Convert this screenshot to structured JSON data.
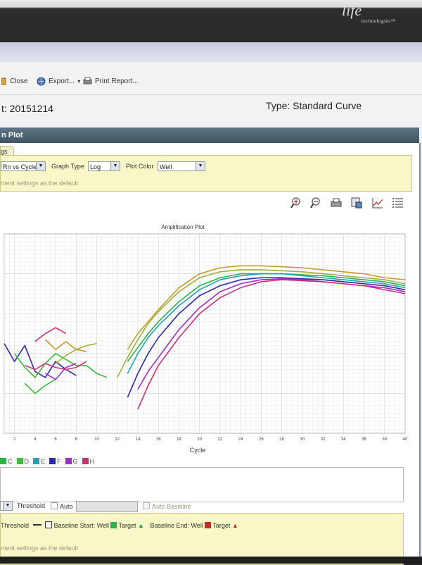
{
  "brand": {
    "logo_main": "life",
    "logo_sub": "technologies™"
  },
  "toolbar": {
    "close": "Close",
    "export": "Export...",
    "print": "Print Report..."
  },
  "experiment": {
    "title": "t: 20151214",
    "type": "Type: Standard Curve"
  },
  "panel": {
    "title": "n Plot",
    "settings_tab": "gs"
  },
  "settings": {
    "plot_type_value": "Rn vs Cycle",
    "graph_type_label": "Graph Type",
    "graph_type_value": "Log",
    "plot_color_label": "Plot Color",
    "plot_color_value": "Well",
    "default_text": "ment settings as the default"
  },
  "plot_toolbar_icons": [
    "zoom-in-icon",
    "zoom-out-icon",
    "print-icon",
    "save-image-icon",
    "line-chart-icon",
    "list-icon"
  ],
  "legend": [
    {
      "label": "C",
      "color": "#2db24a"
    },
    {
      "label": "D",
      "color": "#3cbf3c"
    },
    {
      "label": "E",
      "color": "#21a3b3"
    },
    {
      "label": "F",
      "color": "#2a2aa8"
    },
    {
      "label": "G",
      "color": "#9a2fc9"
    },
    {
      "label": "H",
      "color": "#cc2f7a"
    }
  ],
  "threshold": {
    "label": "Threshold",
    "auto_label": "Auto",
    "auto_baseline_label": "Auto Baseline",
    "row_label": "Threshold",
    "baseline_start": "Baseline Start: Well",
    "target": "Target",
    "baseline_end": "Baseline End: Well",
    "target2": "Target",
    "default_text": "ment settings as the default"
  },
  "chart_data": {
    "type": "line",
    "title": "Amplification Plot",
    "xlabel": "Cycle",
    "ylabel": "",
    "x_ticks": [
      2,
      4,
      6,
      8,
      10,
      12,
      14,
      16,
      18,
      20,
      22,
      24,
      26,
      28,
      30,
      32,
      34,
      36,
      38,
      40
    ],
    "xlim": [
      1,
      40
    ],
    "ylim": [
      0,
      1
    ],
    "log_scale": true,
    "grid": true,
    "series": [
      {
        "color": "#c99a2a",
        "x": [
          13,
          14,
          15,
          16,
          18,
          20,
          22,
          24,
          26,
          28,
          30,
          32,
          34,
          36,
          38,
          40
        ],
        "y": [
          0.42,
          0.5,
          0.56,
          0.62,
          0.73,
          0.8,
          0.83,
          0.84,
          0.84,
          0.835,
          0.83,
          0.82,
          0.81,
          0.8,
          0.78,
          0.77
        ]
      },
      {
        "color": "#9ab23a",
        "x": [
          12,
          13,
          14,
          15,
          16,
          18,
          20,
          22,
          24,
          26,
          28,
          30,
          32,
          34,
          36,
          38,
          40
        ],
        "y": [
          0.28,
          0.38,
          0.47,
          0.55,
          0.61,
          0.71,
          0.78,
          0.81,
          0.82,
          0.82,
          0.815,
          0.81,
          0.8,
          0.79,
          0.78,
          0.77,
          0.75
        ]
      },
      {
        "color": "#2db24a",
        "x": [
          13,
          14,
          15,
          16,
          18,
          20,
          22,
          24,
          26,
          28,
          30,
          32,
          34,
          36,
          38,
          40
        ],
        "y": [
          0.36,
          0.43,
          0.5,
          0.56,
          0.66,
          0.74,
          0.78,
          0.8,
          0.8,
          0.8,
          0.795,
          0.79,
          0.78,
          0.77,
          0.76,
          0.74
        ]
      },
      {
        "color": "#21a3b3",
        "x": [
          13,
          14,
          15,
          16,
          18,
          20,
          22,
          24,
          26,
          28,
          30,
          32,
          34,
          36,
          38,
          40
        ],
        "y": [
          0.3,
          0.4,
          0.48,
          0.54,
          0.64,
          0.72,
          0.77,
          0.79,
          0.8,
          0.8,
          0.79,
          0.78,
          0.77,
          0.76,
          0.75,
          0.73
        ]
      },
      {
        "color": "#2a2aa8",
        "x": [
          13,
          14,
          15,
          16,
          18,
          20,
          22,
          24,
          26,
          28,
          30,
          32,
          34,
          36,
          38,
          40
        ],
        "y": [
          0.18,
          0.3,
          0.4,
          0.48,
          0.6,
          0.69,
          0.74,
          0.77,
          0.78,
          0.78,
          0.775,
          0.77,
          0.76,
          0.75,
          0.74,
          0.72
        ]
      },
      {
        "color": "#9a2fc9",
        "x": [
          14,
          15,
          16,
          18,
          20,
          22,
          24,
          26,
          28,
          30,
          32,
          34,
          36,
          38,
          40
        ],
        "y": [
          0.22,
          0.31,
          0.38,
          0.52,
          0.63,
          0.71,
          0.75,
          0.77,
          0.775,
          0.77,
          0.76,
          0.75,
          0.74,
          0.73,
          0.71
        ]
      },
      {
        "color": "#cc2f7a",
        "x": [
          14,
          15,
          16,
          18,
          20,
          22,
          24,
          26,
          28,
          30,
          32,
          34,
          36,
          38,
          40
        ],
        "y": [
          0.12,
          0.24,
          0.34,
          0.48,
          0.6,
          0.68,
          0.73,
          0.76,
          0.77,
          0.765,
          0.76,
          0.75,
          0.74,
          0.72,
          0.7
        ]
      },
      {
        "color": "#2a2aa8",
        "x": [
          1,
          2,
          3,
          4,
          5,
          6,
          7,
          8
        ],
        "y": [
          0.45,
          0.36,
          0.44,
          0.31,
          0.28,
          0.36,
          0.32,
          0.29
        ]
      },
      {
        "color": "#3cbf3c",
        "x": [
          2,
          3,
          4,
          5,
          6,
          7,
          8,
          9,
          10,
          11
        ],
        "y": [
          0.4,
          0.33,
          0.28,
          0.35,
          0.4,
          0.37,
          0.34,
          0.34,
          0.3,
          0.28
        ]
      },
      {
        "color": "#cc2f7a",
        "x": [
          3,
          4,
          5,
          6,
          7,
          8,
          9
        ],
        "y": [
          0.34,
          0.32,
          0.35,
          0.33,
          0.32,
          0.33,
          0.36
        ]
      },
      {
        "color": "#c99a2a",
        "x": [
          5,
          6,
          7,
          8,
          9
        ],
        "y": [
          0.47,
          0.42,
          0.46,
          0.42,
          0.41
        ]
      },
      {
        "color": "#cc2f7a",
        "x": [
          4,
          5,
          6,
          7
        ],
        "y": [
          0.46,
          0.5,
          0.53,
          0.5
        ]
      },
      {
        "color": "#3cbf3c",
        "x": [
          3,
          4,
          5,
          6
        ],
        "y": [
          0.25,
          0.2,
          0.24,
          0.27
        ]
      },
      {
        "color": "#9ab23a",
        "x": [
          6,
          7,
          8,
          9,
          10
        ],
        "y": [
          0.35,
          0.39,
          0.42,
          0.44,
          0.45
        ]
      },
      {
        "color": "#9a2fc9",
        "x": [
          5,
          6,
          7,
          8
        ],
        "y": [
          0.3,
          0.27,
          0.33,
          0.35
        ]
      }
    ]
  }
}
